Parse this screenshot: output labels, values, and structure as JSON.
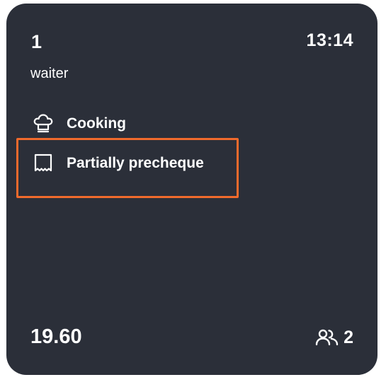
{
  "order_card": {
    "table_number": "1",
    "time": "13:14",
    "waiter": "waiter",
    "statuses": [
      {
        "icon": "chef-hat-icon",
        "label": "Cooking"
      },
      {
        "icon": "receipt-icon",
        "label": "Partially precheque"
      }
    ],
    "total": "19.60",
    "guests": {
      "icon": "users-icon",
      "count": "2"
    }
  },
  "colors": {
    "card_background": "#2b2f39",
    "text": "#ffffff",
    "highlight": "#f06a2c",
    "page_background": "#ffffff"
  }
}
